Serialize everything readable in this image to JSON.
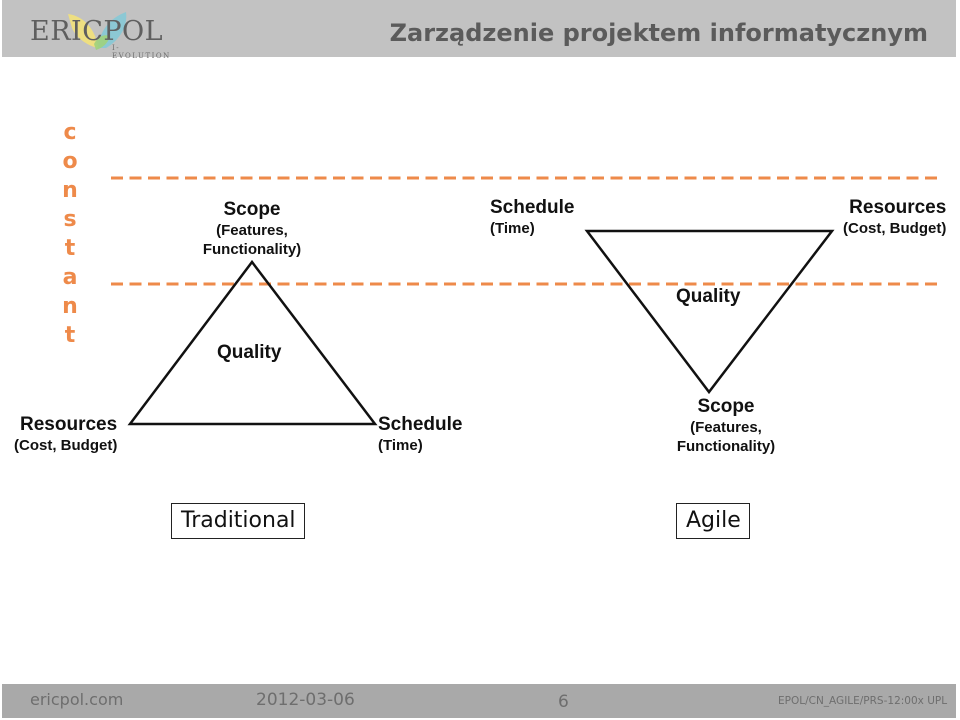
{
  "header": {
    "logo_text": "ERICPOL",
    "logo_subtext": "I-EVOLUTION",
    "title": "Zarządzenie projektem informatycznym"
  },
  "side_label": {
    "letters": [
      "c",
      "o",
      "n",
      "s",
      "t",
      "a",
      "n",
      "t"
    ],
    "word": "constant",
    "color": "#ee8a4a"
  },
  "diagram": {
    "dashed_line_color": "#ee8a4a",
    "traditional": {
      "caption": "Traditional",
      "top": {
        "title": "Scope",
        "line1": "(Features,",
        "line2": "Functionality)"
      },
      "center": {
        "title": "Quality"
      },
      "bottom_left": {
        "title": "Resources",
        "subtitle": "(Cost, Budget)"
      },
      "bottom_right": {
        "title": "Schedule",
        "subtitle": "(Time)"
      }
    },
    "agile": {
      "caption": "Agile",
      "top_left": {
        "title": "Schedule",
        "subtitle": "(Time)"
      },
      "top_right": {
        "title": "Resources",
        "subtitle": "(Cost, Budget)"
      },
      "center": {
        "title": "Quality"
      },
      "bottom": {
        "title": "Scope",
        "line1": "(Features,",
        "line2": "Functionality)"
      }
    }
  },
  "footer": {
    "website": "ericpol.com",
    "date": "2012-03-06",
    "page_number": "6",
    "document_id": "EPOL/CN_AGILE/PRS-12:00x UPL"
  }
}
